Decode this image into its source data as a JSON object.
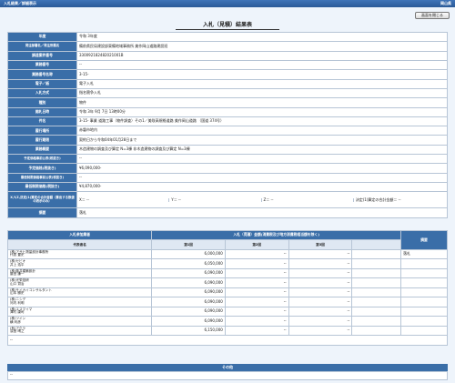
{
  "header": {
    "breadcrumb": "入札結果／詳細表示",
    "agency": "岡山県"
  },
  "close_button": "画面を閉じる",
  "page_title": "入札（見積）結果表",
  "detail": {
    "fiscal_year_label": "年度",
    "fiscal_year": "令和 3年度",
    "orderer_label": "発注部署名／発注所属名",
    "orderer": "備前県民局建設部東備地域事務所 美作岡山道路建設班",
    "tender_no_label": "調達案件番号",
    "tender_no": "330092182482021001B",
    "project_no_label": "業務番号",
    "project_no": "--",
    "project_name_label": "業務番号名称",
    "project_name": "3-15-",
    "epaper_label": "電子／紙",
    "epaper": "電子入札",
    "bid_method_label": "入札方式",
    "bid_method": "指名競争入札",
    "type_label": "種別",
    "type": "物件",
    "open_date_label": "開札日時",
    "open_date": "令和 3年 9月 7日 13時00分",
    "title_label": "件名",
    "title": "3-15- 事業 道路工事（物件調査）その1／美咲高規格道路 美作岡山道路 （国道 374号）",
    "place_label": "履行場所",
    "place": "赤磐市地内",
    "period_label": "履行期限",
    "period": "契約日から令和04年01月28日まで",
    "summary_label": "業務概要",
    "summary": "木造建物の調査及び算定 N=3棟 非木造建物の調査及び算定 N=3棟",
    "planned_label": "予定価格事前公表(税抜き)",
    "planned": "--",
    "planned_post_label": "予定価格(税抜き)",
    "planned_post": "¥6,090,000-",
    "min_pre_label": "最低制限価格事前公表(税抜き)",
    "min_pre": "--",
    "min_post_label": "最低制限価格(税抜き)",
    "min_post": "¥4,870,000-",
    "score_label": "X,Y,Z,決定(1)算定の合計金額（算出する数値の表示のみ）",
    "score_x": "X＝ --",
    "score_y": "Y＝ --",
    "score_z": "Z＝ --",
    "score_decision": "決定(1)算定の合計金額＝ --",
    "remarks_label": "摘要",
    "remarks": "落札"
  },
  "bidders": {
    "participant_label": "入札参加業者",
    "amount_group_label": "入札（見積）金額(消費税及び地方消費税相当額を除く)",
    "remarks_label": "摘要",
    "name_col": "代表者名",
    "round1": "第1回",
    "round2": "第2回",
    "round3": "第3回",
    "rows": [
      {
        "name": "(株)アサヒ測量設計事務所",
        "rep": "代表 豊史",
        "amount": "6,000,000",
        "r2": "--",
        "r3": "--",
        "remark": "落札"
      },
      {
        "name": "(株)セビオ",
        "rep": "井上 浩平",
        "amount": "6,050,000",
        "r2": "--",
        "r3": "--",
        "remark": ""
      },
      {
        "name": "(株)藤井建築設計",
        "rep": "藤田 謙一",
        "amount": "6,090,000",
        "r2": "--",
        "r3": "--",
        "remark": ""
      },
      {
        "name": "(株)光栄技研",
        "rep": "山口 賢治",
        "amount": "6,090,000",
        "r2": "--",
        "r3": "--",
        "remark": ""
      },
      {
        "name": "(株)サイカイコンサルタント",
        "rep": "山本 勝史",
        "amount": "6,090,000",
        "r2": "--",
        "r3": "--",
        "remark": ""
      },
      {
        "name": "(株)ニシデ",
        "rep": "河内 利明",
        "amount": "6,090,000",
        "r2": "--",
        "r3": "--",
        "remark": ""
      },
      {
        "name": "(株)エスマイマ",
        "rep": "澤村 康司",
        "amount": "6,090,000",
        "r2": "--",
        "r3": "--",
        "remark": ""
      },
      {
        "name": "(株)ツイン",
        "rep": "横 利彦",
        "amount": "6,090,000",
        "r2": "--",
        "r3": "--",
        "remark": ""
      },
      {
        "name": "(有)アクラ",
        "rep": "濱島 晴之",
        "amount": "6,150,000",
        "r2": "--",
        "r3": "--",
        "remark": ""
      }
    ],
    "footer_value": "--"
  },
  "other": {
    "label": "その他",
    "value": "--"
  }
}
